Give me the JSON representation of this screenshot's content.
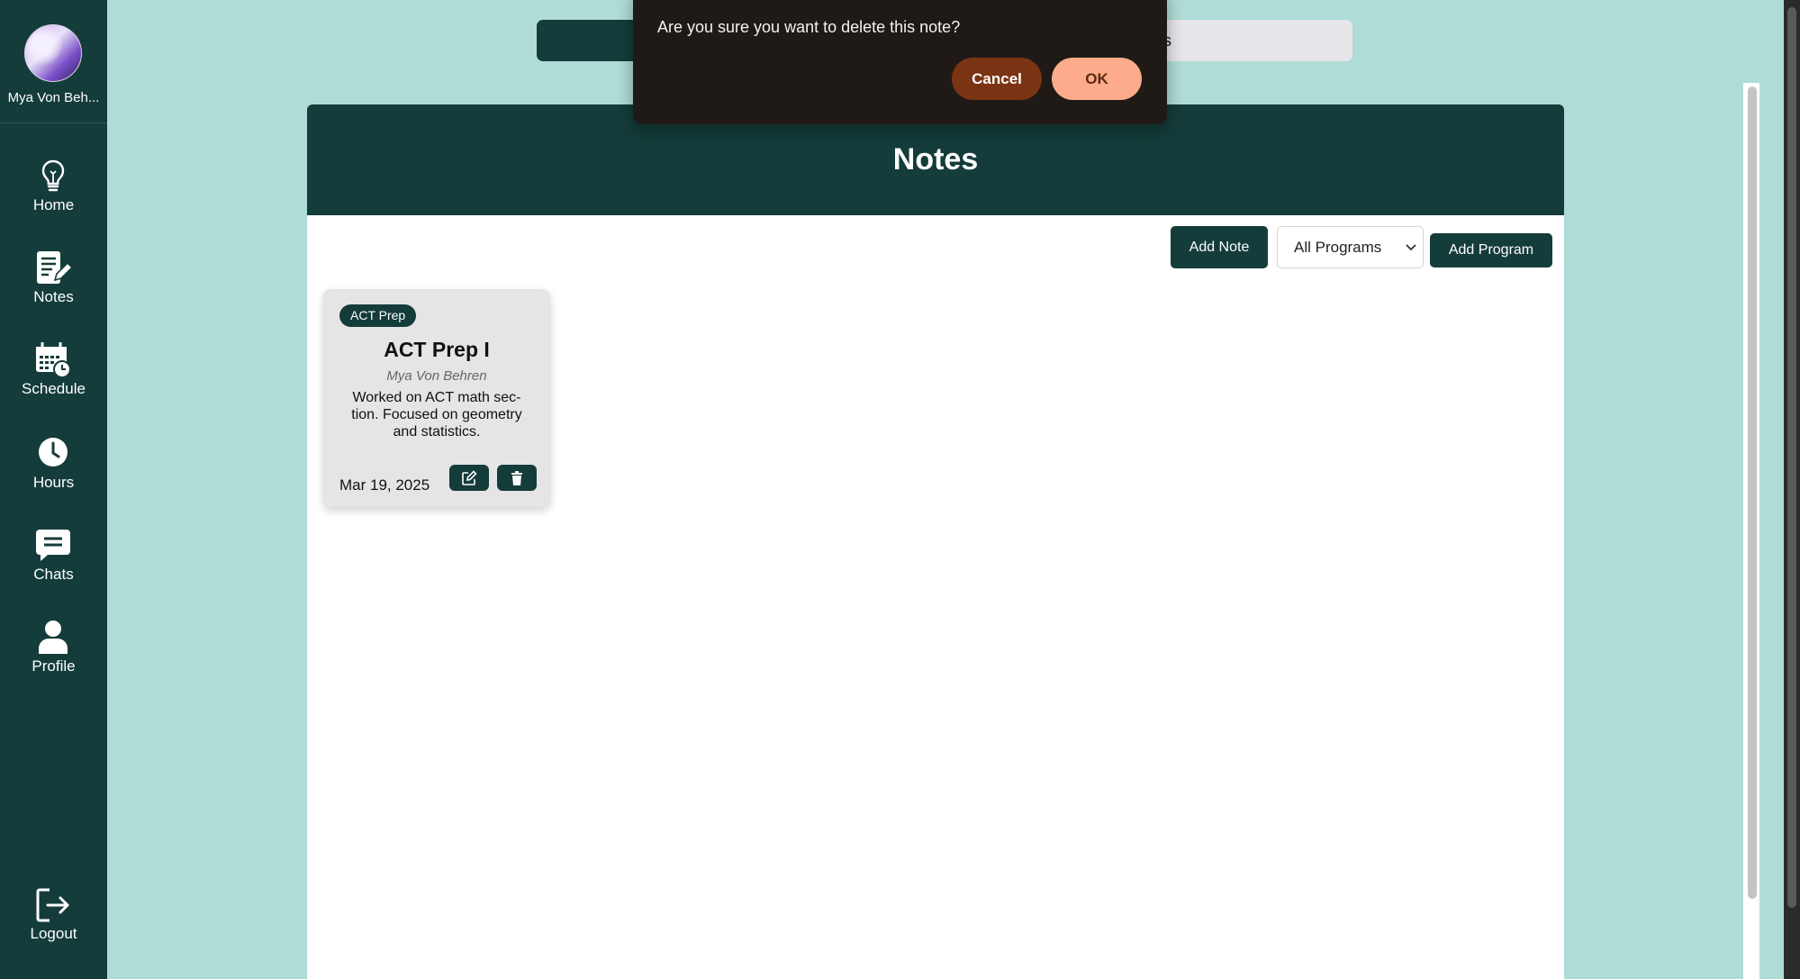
{
  "user": {
    "name": "Mya Von Beh..."
  },
  "nav": {
    "items": [
      {
        "label": "Home",
        "icon": "lightbulb-icon"
      },
      {
        "label": "Notes",
        "icon": "notes-icon"
      },
      {
        "label": "Schedule",
        "icon": "calendar-clock-icon"
      },
      {
        "label": "Hours",
        "icon": "clock-icon"
      },
      {
        "label": "Chats",
        "icon": "chat-icon"
      },
      {
        "label": "Profile",
        "icon": "user-icon"
      }
    ],
    "logout": {
      "label": "Logout",
      "icon": "logout-icon"
    }
  },
  "top_tabs": {
    "right_partial": "es"
  },
  "main": {
    "title": "Notes",
    "add_note_label": "Add Note",
    "program_filter": {
      "selected": "All Programs"
    },
    "add_program_label": "Add Program"
  },
  "notes": [
    {
      "tag": "ACT Prep",
      "title": "ACT Prep I",
      "author": "Mya Von Behren",
      "body": "Worked on ACT math sec-tion. Focused on geometry and statistics.",
      "date": "Mar 19, 2025"
    }
  ],
  "dialog": {
    "message": "Are you sure you want to delete this note?",
    "cancel_label": "Cancel",
    "ok_label": "OK"
  },
  "colors": {
    "background": "#afdcd6",
    "sidebar": "#143c3a",
    "primary": "#143c3a",
    "card": "#e5e5e5",
    "dialog": "#201a17",
    "cancel": "#7b3413",
    "ok": "#fcac8b"
  }
}
